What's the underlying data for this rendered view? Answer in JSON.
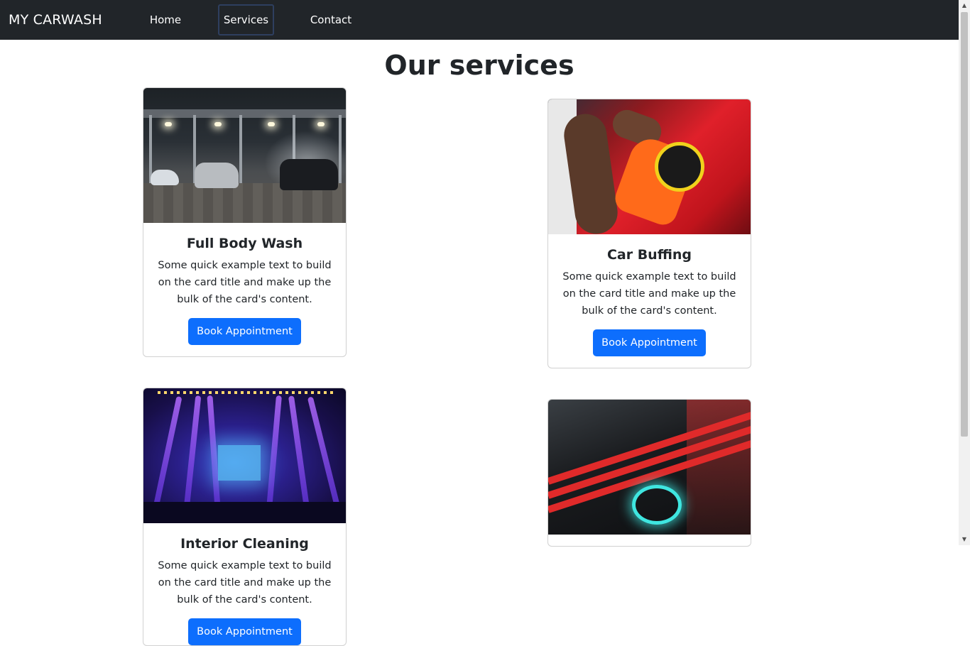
{
  "navbar": {
    "brand": "MY CARWASH",
    "links": [
      {
        "label": "Home"
      },
      {
        "label": "Services"
      },
      {
        "label": "Contact"
      }
    ]
  },
  "page": {
    "title": "Our services"
  },
  "cards": [
    {
      "title": "Full Body Wash",
      "text": "Some quick example text to build on the card title and make up the bulk of the card's content.",
      "button": "Book Appointment"
    },
    {
      "title": "Car Buffing",
      "text": "Some quick example text to build on the card title and make up the bulk of the card's content.",
      "button": "Book Appointment"
    },
    {
      "title": "Interior Cleaning",
      "text": "Some quick example text to build on the card title and make up the bulk of the card's content.",
      "button": "Book Appointment"
    },
    {
      "title": "",
      "text": "",
      "button": ""
    }
  ],
  "colors": {
    "navbar_bg": "#212529",
    "primary_button": "#0d6efd",
    "text": "#212529"
  }
}
